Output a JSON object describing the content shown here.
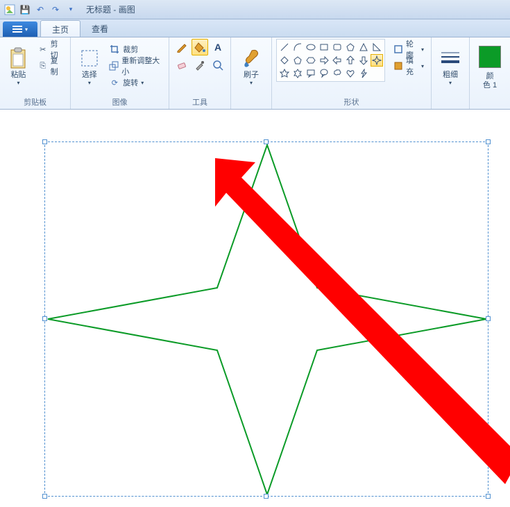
{
  "titlebar": {
    "doc_title": "无标题",
    "app_name": "画图"
  },
  "tabs": {
    "file": "",
    "home": "主页",
    "view": "查看"
  },
  "groups": {
    "clipboard": {
      "label": "剪贴板",
      "paste": "粘贴",
      "cut": "剪切",
      "copy": "复制"
    },
    "image": {
      "label": "图像",
      "select": "选择",
      "crop": "裁剪",
      "resize": "重新调整大小",
      "rotate": "旋转"
    },
    "tools": {
      "label": "工具"
    },
    "brushes": {
      "label": "刷子"
    },
    "shapes": {
      "label": "形状",
      "outline": "轮廓",
      "fill": "填充"
    },
    "stroke": {
      "label": "粗细"
    },
    "colors": {
      "color1_line1": "颜",
      "color1_line2": "色 1"
    }
  },
  "icons": {
    "save": "💾",
    "undo": "↶",
    "redo": "↷",
    "dropdown": "▾",
    "scissors": "✂",
    "copy": "📄",
    "clipboard": "📋",
    "select_dashed": "⬚",
    "crop": "⊏⊐",
    "resize": "⤢",
    "rotate": "⟳",
    "pencil": "✎",
    "bucket": "◣",
    "text": "A",
    "eraser": "▱",
    "eyedropper": "⁋",
    "magnifier": "🔍",
    "brush": "🖌",
    "outline_ic": "◇",
    "fill_ic": "◆"
  }
}
